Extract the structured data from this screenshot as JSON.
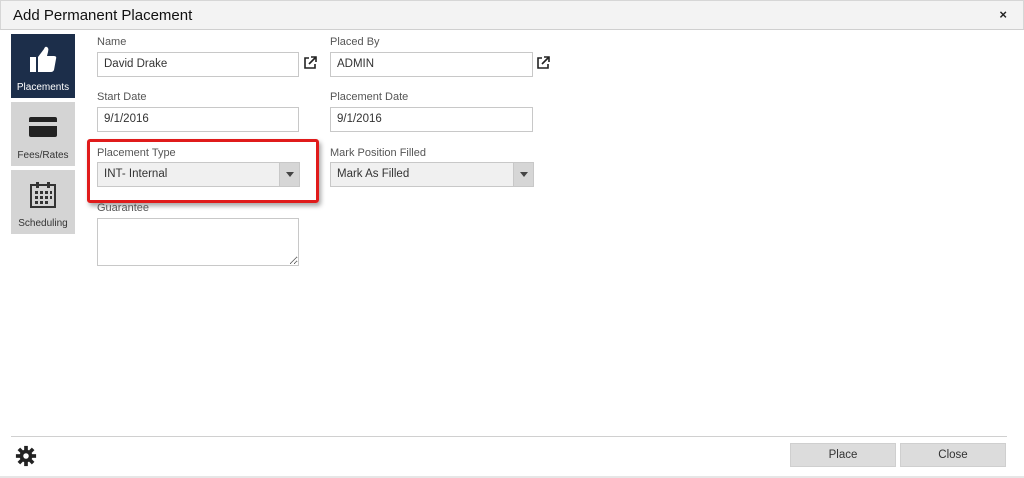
{
  "dialog": {
    "title": "Add Permanent Placement",
    "close_symbol": "×"
  },
  "nav": {
    "items": [
      {
        "label": "Placements",
        "icon": "thumbs-up-icon",
        "active": true
      },
      {
        "label": "Fees/Rates",
        "icon": "credit-card-icon",
        "active": false
      },
      {
        "label": "Scheduling",
        "icon": "calendar-icon",
        "active": false
      }
    ]
  },
  "form": {
    "name": {
      "label": "Name",
      "value": "David Drake"
    },
    "placed_by": {
      "label": "Placed By",
      "value": "ADMIN"
    },
    "start_date": {
      "label": "Start Date",
      "value": "9/1/2016"
    },
    "placement_date": {
      "label": "Placement Date",
      "value": "9/1/2016"
    },
    "placement_type": {
      "label": "Placement Type",
      "value": "INT- Internal"
    },
    "mark_position_filled": {
      "label": "Mark Position Filled",
      "value": "Mark As Filled"
    },
    "guarantee": {
      "label": "Guarantee",
      "value": ""
    }
  },
  "footer": {
    "place_label": "Place",
    "close_label": "Close"
  },
  "colors": {
    "nav_active": "#1c2e4a",
    "highlight": "#e01b1b"
  }
}
